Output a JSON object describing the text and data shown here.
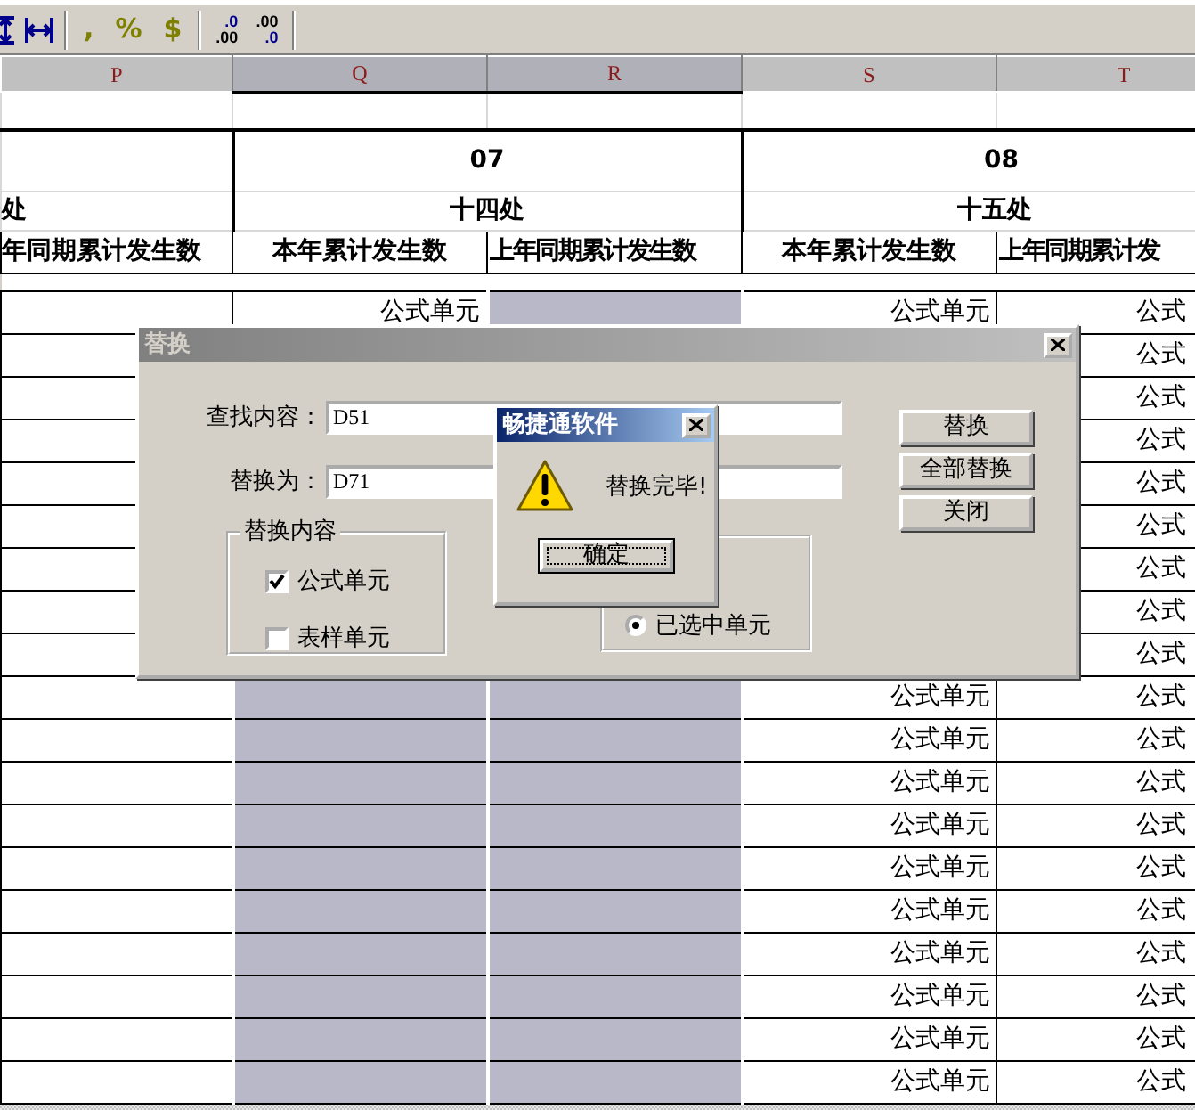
{
  "toolbar": [
    {
      "kind": "row-height"
    },
    {
      "kind": "column-width"
    },
    {
      "kind": "separator"
    },
    {
      "kind": "glyph",
      "text": ","
    },
    {
      "kind": "glyph",
      "text": "%"
    },
    {
      "kind": "glyph",
      "text": "$"
    },
    {
      "kind": "separator"
    },
    {
      "kind": "increase-decimal",
      "lines": [
        ".0",
        ".00"
      ]
    },
    {
      "kind": "decrease-decimal",
      "lines": [
        ".00",
        ".0"
      ]
    },
    {
      "kind": "separator"
    }
  ],
  "columns": [
    {
      "label": "P",
      "selected": false
    },
    {
      "label": "Q",
      "selected": true
    },
    {
      "label": "R",
      "selected": true
    },
    {
      "label": "S",
      "selected": false
    },
    {
      "label": "T",
      "selected": false
    }
  ],
  "left_column": {
    "name": "处",
    "measure": "年同期累计发生数"
  },
  "groups": [
    {
      "code": "07",
      "name": "十四处",
      "measures": [
        "本年累计发生数",
        "上年同期累计发生数"
      ]
    },
    {
      "code": "08",
      "name": "十五处",
      "measures": [
        "本年累计发生数",
        "上年同期累计发"
      ]
    }
  ],
  "rows": [
    {
      "cells": [
        {
          "selected": false
        },
        {
          "text": "公式单元",
          "selected": false
        },
        {
          "selected": true
        },
        {
          "text": "公式单元",
          "selected": false
        },
        {
          "text": "公式",
          "selected": false
        }
      ]
    },
    {
      "cells": [
        {
          "selected": false
        },
        null,
        null,
        null,
        {
          "text": "公式",
          "selected": false
        }
      ]
    },
    {
      "cells": [
        {
          "selected": false
        },
        null,
        null,
        null,
        {
          "text": "公式",
          "selected": false
        }
      ]
    },
    {
      "cells": [
        {
          "selected": false
        },
        null,
        null,
        null,
        {
          "text": "公式",
          "selected": false
        }
      ]
    },
    {
      "cells": [
        {
          "selected": false
        },
        null,
        null,
        null,
        {
          "text": "公式",
          "selected": false
        }
      ]
    },
    {
      "cells": [
        {
          "selected": false
        },
        null,
        null,
        null,
        {
          "text": "公式",
          "selected": false
        }
      ]
    },
    {
      "cells": [
        {
          "selected": false
        },
        null,
        null,
        null,
        {
          "text": "公式",
          "selected": false
        }
      ]
    },
    {
      "cells": [
        {
          "selected": false
        },
        null,
        null,
        null,
        {
          "text": "公式",
          "selected": false
        }
      ]
    },
    {
      "cells": [
        {
          "selected": false
        },
        null,
        null,
        null,
        {
          "text": "公式",
          "selected": false
        }
      ]
    },
    {
      "cells": [
        {
          "selected": false
        },
        {
          "selected": true
        },
        {
          "selected": true
        },
        {
          "text": "公式单元",
          "selected": false
        },
        {
          "text": "公式",
          "selected": false
        }
      ]
    },
    {
      "cells": [
        {
          "selected": false
        },
        {
          "selected": true
        },
        {
          "selected": true
        },
        {
          "text": "公式单元",
          "selected": false
        },
        {
          "text": "公式",
          "selected": false
        }
      ]
    },
    {
      "cells": [
        {
          "selected": false
        },
        {
          "selected": true
        },
        {
          "selected": true
        },
        {
          "text": "公式单元",
          "selected": false
        },
        {
          "text": "公式",
          "selected": false
        }
      ]
    },
    {
      "cells": [
        {
          "selected": false
        },
        {
          "selected": true
        },
        {
          "selected": true
        },
        {
          "text": "公式单元",
          "selected": false
        },
        {
          "text": "公式",
          "selected": false
        }
      ]
    },
    {
      "cells": [
        {
          "selected": false
        },
        {
          "selected": true
        },
        {
          "selected": true
        },
        {
          "text": "公式单元",
          "selected": false
        },
        {
          "text": "公式",
          "selected": false
        }
      ]
    },
    {
      "cells": [
        {
          "selected": false
        },
        {
          "selected": true
        },
        {
          "selected": true
        },
        {
          "text": "公式单元",
          "selected": false
        },
        {
          "text": "公式",
          "selected": false
        }
      ]
    },
    {
      "cells": [
        {
          "selected": false
        },
        {
          "selected": true
        },
        {
          "selected": true
        },
        {
          "text": "公式单元",
          "selected": false
        },
        {
          "text": "公式",
          "selected": false
        }
      ]
    },
    {
      "cells": [
        {
          "selected": false
        },
        {
          "selected": true
        },
        {
          "selected": true
        },
        {
          "text": "公式单元",
          "selected": false
        },
        {
          "text": "公式",
          "selected": false
        }
      ]
    },
    {
      "cells": [
        {
          "selected": false
        },
        {
          "selected": true
        },
        {
          "selected": true
        },
        {
          "text": "公式单元",
          "selected": false
        },
        {
          "text": "公式",
          "selected": false
        }
      ]
    },
    {
      "cells": [
        {
          "selected": false
        },
        {
          "selected": true
        },
        {
          "selected": true
        },
        {
          "text": "公式单元",
          "selected": false
        },
        {
          "text": "公式",
          "selected": false
        }
      ]
    }
  ],
  "replace_dialog": {
    "title": "替换",
    "active": false,
    "fields": [
      {
        "label": "查找内容：",
        "value": "D51"
      },
      {
        "label": "替换为：",
        "value": "D71"
      }
    ],
    "buttons": [
      "替换",
      "全部替换",
      "关闭"
    ],
    "content_group": {
      "title": "替换内容",
      "options": [
        {
          "label": "公式单元",
          "checked": true
        },
        {
          "label": "表样单元",
          "checked": false
        }
      ]
    },
    "scope_group": {
      "options": [
        {
          "label": "已选中单元",
          "selected": true
        }
      ]
    }
  },
  "message_box": {
    "title": "畅捷通软件",
    "active": true,
    "message": "替换完毕!",
    "button": "确定",
    "focused": true
  }
}
